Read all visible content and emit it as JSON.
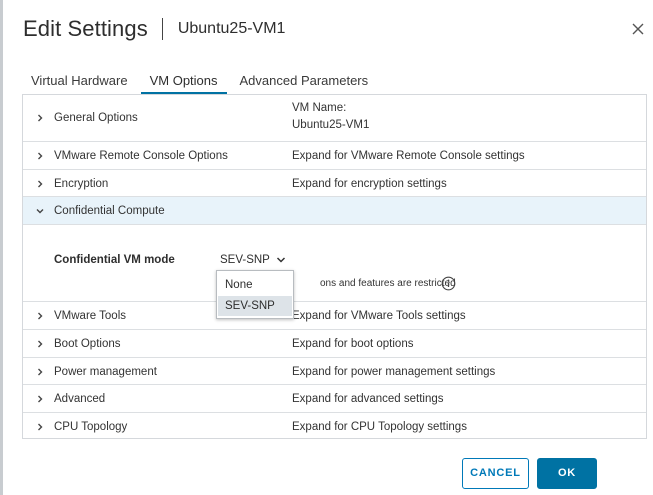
{
  "dialog": {
    "title": "Edit Settings",
    "subtitle": "Ubuntu25-VM1",
    "close_icon": "close-icon"
  },
  "tabs": [
    {
      "label": "Virtual Hardware",
      "active": false
    },
    {
      "label": "VM Options",
      "active": true
    },
    {
      "label": "Advanced Parameters",
      "active": false
    }
  ],
  "rows": {
    "general_options": {
      "label": "General Options",
      "value_line1": "VM Name:",
      "value_line2": "Ubuntu25-VM1"
    },
    "remote_console": {
      "label": "VMware Remote Console Options",
      "value": "Expand for VMware Remote Console settings"
    },
    "encryption": {
      "label": "Encryption",
      "value": "Expand for encryption settings"
    },
    "confidential_compute": {
      "label": "Confidential Compute",
      "expanded": true
    },
    "vmware_tools": {
      "label": "VMware Tools",
      "value": "Expand for VMware Tools settings"
    },
    "boot_options": {
      "label": "Boot Options",
      "value": "Expand for boot options"
    },
    "power_management": {
      "label": "Power management",
      "value": "Expand for power management settings"
    },
    "advanced": {
      "label": "Advanced",
      "value": "Expand for advanced settings"
    },
    "cpu_topology": {
      "label": "CPU Topology",
      "value": "Expand for CPU Topology settings"
    }
  },
  "confidential": {
    "mode_label": "Confidential VM mode",
    "mode_value": "SEV-SNP",
    "note_visible": "ons and features are restricted",
    "options": [
      "None",
      "SEV-SNP"
    ],
    "selected_option": "SEV-SNP"
  },
  "buttons": {
    "cancel": "CANCEL",
    "ok": "OK"
  },
  "colors": {
    "accent": "#0072a3",
    "expanded_row_bg": "#e8f3fa",
    "selected_option_bg": "#dde3e8"
  }
}
